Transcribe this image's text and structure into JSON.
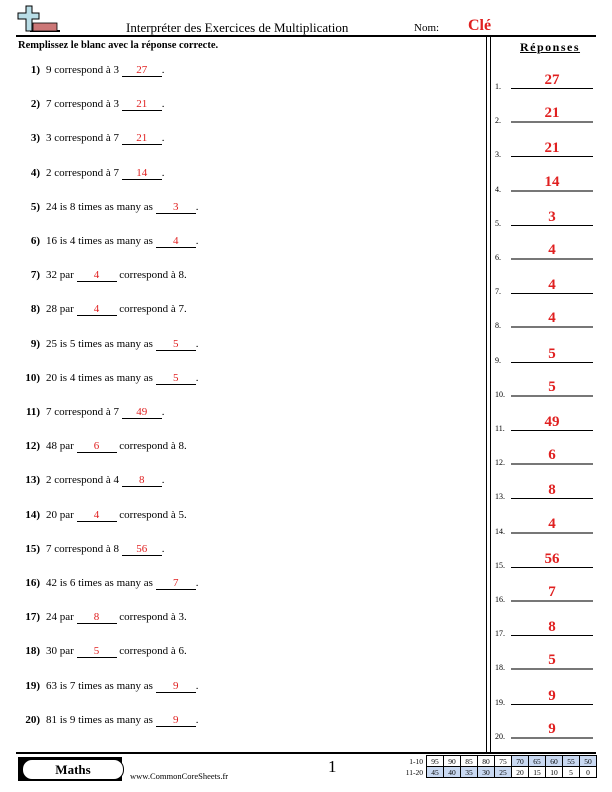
{
  "header": {
    "title": "Interpréter des Exercices de Multiplication",
    "name_label": "Nom:",
    "name_value": "Clé",
    "logo_icon": "plus-minus-icon"
  },
  "instructions": "Remplissez le blanc avec la réponse correcte.",
  "answers_heading": "Réponses",
  "questions": [
    {
      "num": "1)",
      "before": "9 correspond à 3",
      "answer": "27",
      "after": "."
    },
    {
      "num": "2)",
      "before": "7 correspond à 3",
      "answer": "21",
      "after": "."
    },
    {
      "num": "3)",
      "before": "3 correspond à 7",
      "answer": "21",
      "after": "."
    },
    {
      "num": "4)",
      "before": "2 correspond à 7",
      "answer": "14",
      "after": "."
    },
    {
      "num": "5)",
      "before": "24 is 8 times as many as",
      "answer": "3",
      "after": "."
    },
    {
      "num": "6)",
      "before": "16 is 4 times as many as",
      "answer": "4",
      "after": "."
    },
    {
      "num": "7)",
      "before": "32 par",
      "answer": "4",
      "after": "correspond à 8."
    },
    {
      "num": "8)",
      "before": "28 par",
      "answer": "4",
      "after": "correspond à 7."
    },
    {
      "num": "9)",
      "before": "25 is 5 times as many as",
      "answer": "5",
      "after": "."
    },
    {
      "num": "10)",
      "before": "20 is 4 times as many as",
      "answer": "5",
      "after": "."
    },
    {
      "num": "11)",
      "before": "7 correspond à 7",
      "answer": "49",
      "after": "."
    },
    {
      "num": "12)",
      "before": "48 par",
      "answer": "6",
      "after": "correspond à 8."
    },
    {
      "num": "13)",
      "before": "2 correspond à 4",
      "answer": "8",
      "after": "."
    },
    {
      "num": "14)",
      "before": "20 par",
      "answer": "4",
      "after": "correspond à 5."
    },
    {
      "num": "15)",
      "before": "7 correspond à 8",
      "answer": "56",
      "after": "."
    },
    {
      "num": "16)",
      "before": "42 is 6 times as many as",
      "answer": "7",
      "after": "."
    },
    {
      "num": "17)",
      "before": "24 par",
      "answer": "8",
      "after": "correspond à 3."
    },
    {
      "num": "18)",
      "before": "30 par",
      "answer": "5",
      "after": "correspond à 6."
    },
    {
      "num": "19)",
      "before": "63 is 7 times as many as",
      "answer": "9",
      "after": "."
    },
    {
      "num": "20)",
      "before": "81 is 9 times as many as",
      "answer": "9",
      "after": "."
    }
  ],
  "answer_key": [
    {
      "num": "1.",
      "value": "27"
    },
    {
      "num": "2.",
      "value": "21"
    },
    {
      "num": "3.",
      "value": "21"
    },
    {
      "num": "4.",
      "value": "14"
    },
    {
      "num": "5.",
      "value": "3"
    },
    {
      "num": "6.",
      "value": "4"
    },
    {
      "num": "7.",
      "value": "4"
    },
    {
      "num": "8.",
      "value": "4"
    },
    {
      "num": "9.",
      "value": "5"
    },
    {
      "num": "10.",
      "value": "5"
    },
    {
      "num": "11.",
      "value": "49"
    },
    {
      "num": "12.",
      "value": "6"
    },
    {
      "num": "13.",
      "value": "8"
    },
    {
      "num": "14.",
      "value": "4"
    },
    {
      "num": "15.",
      "value": "56"
    },
    {
      "num": "16.",
      "value": "7"
    },
    {
      "num": "17.",
      "value": "8"
    },
    {
      "num": "18.",
      "value": "5"
    },
    {
      "num": "19.",
      "value": "9"
    },
    {
      "num": "20.",
      "value": "9"
    }
  ],
  "footer": {
    "subject": "Maths",
    "website": "www.CommonCoreSheets.fr",
    "page_number": "1",
    "score_table": [
      {
        "label": "1-10",
        "cells": [
          "95",
          "90",
          "85",
          "80",
          "75",
          "70",
          "65",
          "60",
          "55",
          "50"
        ]
      },
      {
        "label": "11-20",
        "cells": [
          "45",
          "40",
          "35",
          "30",
          "25",
          "20",
          "15",
          "10",
          "5",
          "0"
        ]
      }
    ],
    "highlight_color": "#c9d9f2"
  },
  "colors": {
    "answer": "#e02020"
  }
}
